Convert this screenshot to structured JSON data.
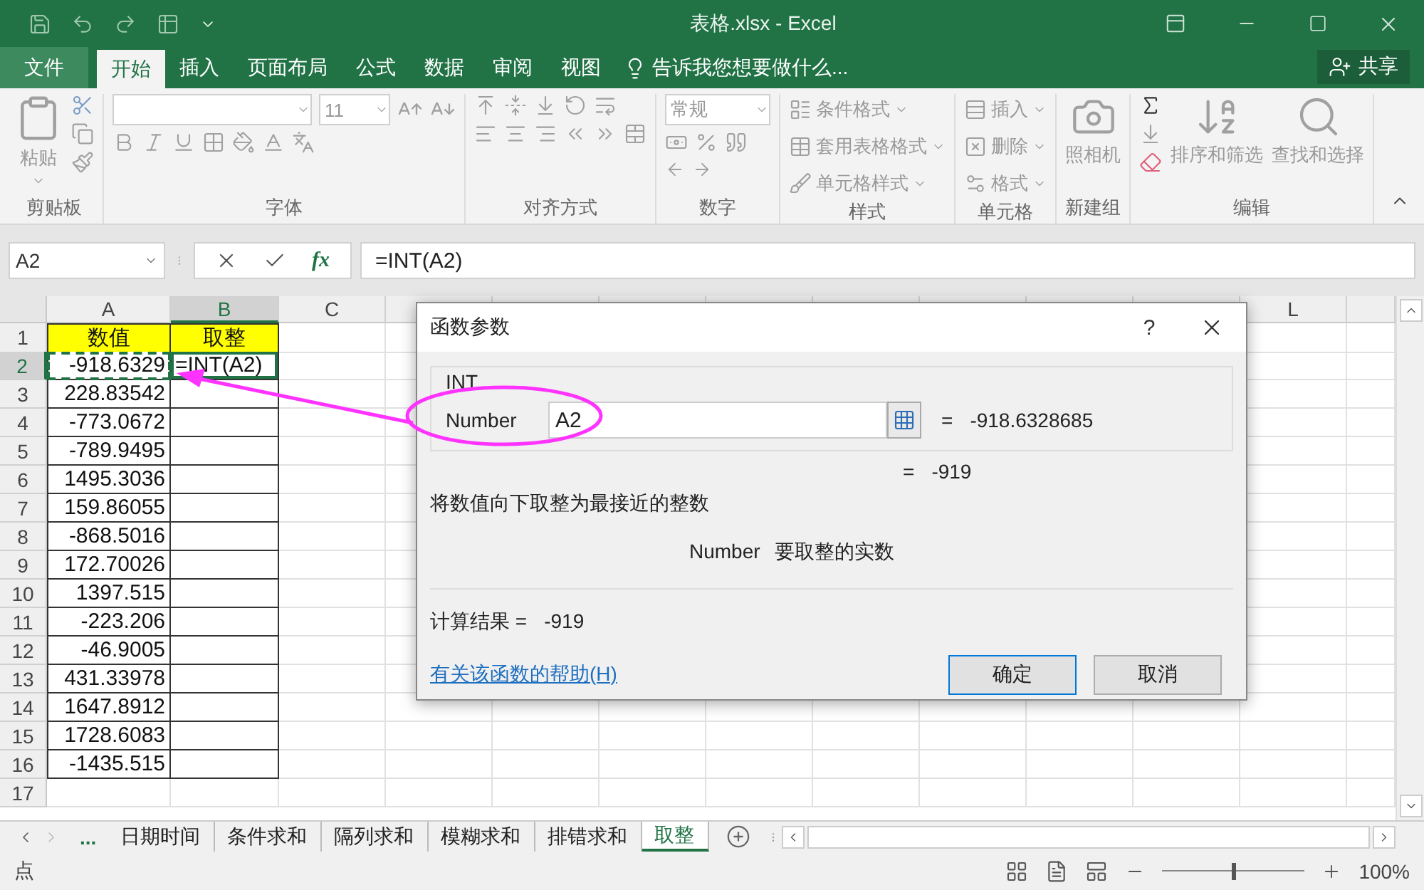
{
  "title_bar": {
    "title": "表格.xlsx - Excel"
  },
  "ribbon_tabs": [
    {
      "label": "文件",
      "kind": "file",
      "selected": false
    },
    {
      "label": "开始",
      "kind": "tab",
      "selected": true
    },
    {
      "label": "插入",
      "kind": "tab",
      "selected": false
    },
    {
      "label": "页面布局",
      "kind": "tab",
      "selected": false
    },
    {
      "label": "公式",
      "kind": "tab",
      "selected": false
    },
    {
      "label": "数据",
      "kind": "tab",
      "selected": false
    },
    {
      "label": "审阅",
      "kind": "tab",
      "selected": false
    },
    {
      "label": "视图",
      "kind": "tab",
      "selected": false
    }
  ],
  "tell_me": "告诉我您想要做什么...",
  "share_button": "共享",
  "ribbon": {
    "disabled": true,
    "clipboard": {
      "label": "剪贴板",
      "paste": "粘贴"
    },
    "font": {
      "label": "字体",
      "size": "11"
    },
    "alignment": {
      "label": "对齐方式"
    },
    "number": {
      "label": "数字",
      "format": "常规"
    },
    "styles": {
      "label": "样式",
      "items": [
        "条件格式",
        "套用表格格式",
        "单元格样式"
      ]
    },
    "cells": {
      "label": "单元格",
      "items": [
        "插入",
        "删除",
        "格式"
      ]
    },
    "new_group": {
      "label": "新建组",
      "camera": "照相机"
    },
    "editing": {
      "label": "编辑",
      "sort": "排序和筛选",
      "find": "查找和选择"
    }
  },
  "formula_bar": {
    "name_box": "A2",
    "fx": "fx",
    "formula": "=INT(A2)"
  },
  "columns": [
    {
      "label": "A",
      "selected": false
    },
    {
      "label": "B",
      "selected": true
    },
    {
      "label": "C",
      "selected": false
    },
    {
      "label": "L",
      "selected": false
    }
  ],
  "rows": [
    {
      "header": "1",
      "selected": false,
      "kind": "heading",
      "cells": [
        {
          "text": "数值",
          "active": false,
          "referenced": false
        },
        {
          "text": "取整",
          "active": false,
          "referenced": false
        }
      ]
    },
    {
      "header": "2",
      "selected": true,
      "kind": "data",
      "cells": [
        {
          "text": "-918.6329",
          "active": false,
          "referenced": true
        },
        {
          "text": "=INT(A2)",
          "active": true,
          "referenced": false
        }
      ]
    },
    {
      "header": "3",
      "selected": false,
      "kind": "data",
      "cells": [
        {
          "text": "228.83542",
          "active": false,
          "referenced": false
        },
        {
          "active": false,
          "referenced": false
        }
      ]
    },
    {
      "header": "4",
      "selected": false,
      "kind": "data",
      "cells": [
        {
          "text": "-773.0672",
          "active": false,
          "referenced": false
        },
        {
          "active": false,
          "referenced": false
        }
      ]
    },
    {
      "header": "5",
      "selected": false,
      "kind": "data",
      "cells": [
        {
          "text": "-789.9495",
          "active": false,
          "referenced": false
        },
        {
          "active": false,
          "referenced": false
        }
      ]
    },
    {
      "header": "6",
      "selected": false,
      "kind": "data",
      "cells": [
        {
          "text": "1495.3036",
          "active": false,
          "referenced": false
        },
        {
          "active": false,
          "referenced": false
        }
      ]
    },
    {
      "header": "7",
      "selected": false,
      "kind": "data",
      "cells": [
        {
          "text": "159.86055",
          "active": false,
          "referenced": false
        },
        {
          "active": false,
          "referenced": false
        }
      ]
    },
    {
      "header": "8",
      "selected": false,
      "kind": "data",
      "cells": [
        {
          "text": "-868.5016",
          "active": false,
          "referenced": false
        },
        {
          "active": false,
          "referenced": false
        }
      ]
    },
    {
      "header": "9",
      "selected": false,
      "kind": "data",
      "cells": [
        {
          "text": "172.70026",
          "active": false,
          "referenced": false
        },
        {
          "active": false,
          "referenced": false
        }
      ]
    },
    {
      "header": "10",
      "selected": false,
      "kind": "data",
      "cells": [
        {
          "text": "1397.515",
          "active": false,
          "referenced": false
        },
        {
          "active": false,
          "referenced": false
        }
      ]
    },
    {
      "header": "11",
      "selected": false,
      "kind": "data",
      "cells": [
        {
          "text": "-223.206",
          "active": false,
          "referenced": false
        },
        {
          "active": false,
          "referenced": false
        }
      ]
    },
    {
      "header": "12",
      "selected": false,
      "kind": "data",
      "cells": [
        {
          "text": "-46.9005",
          "active": false,
          "referenced": false
        },
        {
          "active": false,
          "referenced": false
        }
      ]
    },
    {
      "header": "13",
      "selected": false,
      "kind": "data",
      "cells": [
        {
          "text": "431.33978",
          "active": false,
          "referenced": false
        },
        {
          "active": false,
          "referenced": false
        }
      ]
    },
    {
      "header": "14",
      "selected": false,
      "kind": "data",
      "cells": [
        {
          "text": "1647.8912",
          "active": false,
          "referenced": false
        },
        {
          "active": false,
          "referenced": false
        }
      ]
    },
    {
      "header": "15",
      "selected": false,
      "kind": "data",
      "cells": [
        {
          "text": "1728.6083",
          "active": false,
          "referenced": false
        },
        {
          "active": false,
          "referenced": false
        }
      ]
    },
    {
      "header": "16",
      "selected": false,
      "kind": "data",
      "cells": [
        {
          "text": "-1435.515",
          "active": false,
          "referenced": false
        },
        {
          "active": false,
          "referenced": false
        }
      ]
    },
    {
      "header": "17",
      "selected": false,
      "kind": "blank"
    }
  ],
  "dialog": {
    "title": "函数参数",
    "help_button": "?",
    "function_name": "INT",
    "argument": {
      "label": "Number",
      "value": "A2",
      "equals": "=",
      "result": "-918.6328685"
    },
    "preview": {
      "equals": "=",
      "value": "-919"
    },
    "description": "将数值向下取整为最接近的整数",
    "argument_help": {
      "name": "Number",
      "text": "要取整的实数"
    },
    "result_label": "计算结果 =",
    "result": "-919",
    "help_link": "有关该函数的帮助(H)",
    "buttons": [
      {
        "label": "确定",
        "default": true
      },
      {
        "label": "取消",
        "default": false
      }
    ]
  },
  "sheet_tabs": {
    "more": "...",
    "tabs": [
      {
        "label": "日期时间",
        "selected": false
      },
      {
        "label": "条件求和",
        "selected": false
      },
      {
        "label": "隔列求和",
        "selected": false
      },
      {
        "label": "模糊求和",
        "selected": false
      },
      {
        "label": "排错求和",
        "selected": false
      },
      {
        "label": "取整",
        "selected": true
      }
    ]
  },
  "status_bar": {
    "mode": "点",
    "zoom": {
      "level": 0.5,
      "reading": "100%"
    }
  }
}
